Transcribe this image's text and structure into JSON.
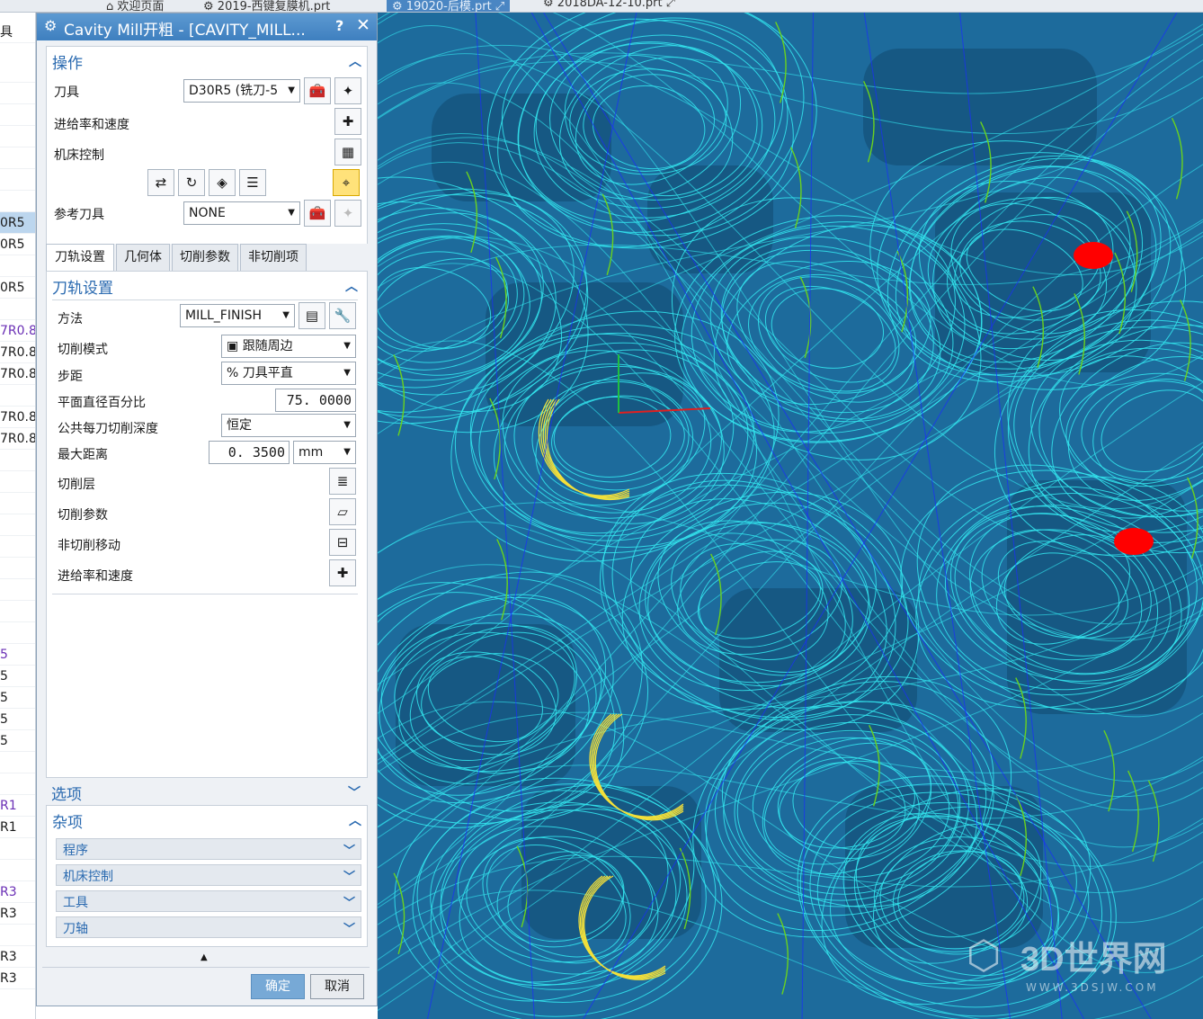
{
  "tabs": [
    {
      "label": "欢迎页面"
    },
    {
      "label": "2019-西键复膜机.prt"
    },
    {
      "label": "19020-后模.prt"
    },
    {
      "label": "2018DA-12-10.prt"
    }
  ],
  "left_strip": {
    "header": "具",
    "rows": [
      "",
      "",
      "",
      "",
      "",
      "",
      "",
      "0R5",
      "0R5",
      "",
      "0R5",
      "",
      "7R0.8",
      "7R0.8",
      "7R0.8",
      "",
      "7R0.8",
      "7R0.8",
      "",
      "",
      "",
      "",
      "",
      "",
      "",
      "",
      "",
      "5",
      "5",
      "5",
      "5",
      "5",
      "",
      "",
      "R1",
      "R1",
      "",
      "",
      "R3",
      "R3",
      "",
      "R3",
      "R3"
    ],
    "selected_index": 7
  },
  "dialog": {
    "title": "Cavity Mill开粗 - [CAVITY_MILL...",
    "help": "?",
    "close": "✕",
    "operation": {
      "header": "操作",
      "tool_label": "刀具",
      "tool_value": "D30R5 (铣刀-5",
      "feeds_label": "进给率和速度",
      "machine_label": "机床控制",
      "ref_tool_label": "参考刀具",
      "ref_tool_value": "NONE"
    },
    "tabs": [
      "刀轨设置",
      "几何体",
      "切削参数",
      "非切削项"
    ],
    "path": {
      "header": "刀轨设置",
      "method_label": "方法",
      "method_value": "MILL_FINISH",
      "cut_mode_label": "切削模式",
      "cut_mode_value": "跟随周边",
      "stepover_label": "步距",
      "stepover_value": "% 刀具平直",
      "percent_label": "平面直径百分比",
      "percent_value": "75. 0000",
      "depth_label": "公共每刀切削深度",
      "depth_value": "恒定",
      "max_dist_label": "最大距离",
      "max_dist_value": "0. 3500",
      "unit_value": "mm",
      "cut_levels_label": "切削层",
      "cut_params_label": "切削参数",
      "noncut_label": "非切削移动",
      "feeds_label": "进给率和速度"
    },
    "options_header": "选项",
    "misc": {
      "header": "杂项",
      "items": [
        "程序",
        "机床控制",
        "工具",
        "刀轴"
      ]
    },
    "ok_label": "确定",
    "cancel_label": "取消"
  },
  "watermark": {
    "main": "3D世界网",
    "sub": "WWW.3DSJW.COM"
  },
  "colors": {
    "viewport_bg": "#1d6b9c",
    "toolpath": "#34e8f0",
    "toolpath_green": "#6ad21e",
    "toolpath_yellow": "#f3e03a",
    "marker": "#ff0000",
    "accent": "#2a6ab0"
  }
}
